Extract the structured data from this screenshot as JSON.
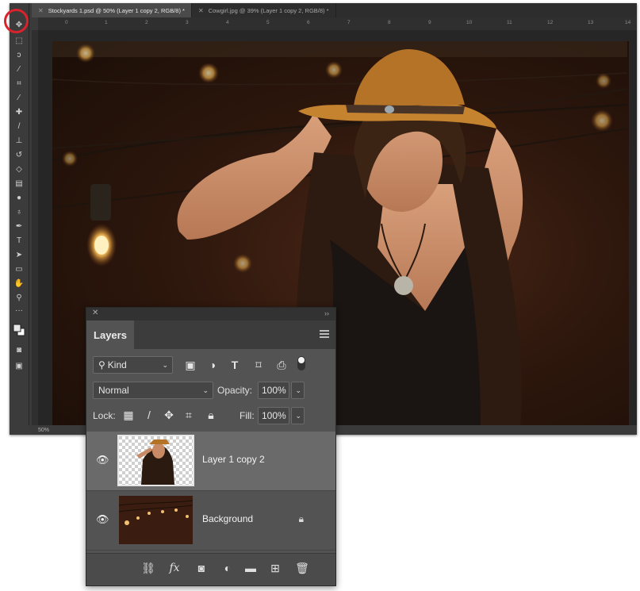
{
  "tabs": [
    {
      "label": "Stockyards 1.psd @ 50% (Layer 1 copy 2, RGB/8) *",
      "active": true
    },
    {
      "label": "Cowgirl.jpg @ 39% (Layer 1 copy 2, RGB/8) *",
      "active": false
    }
  ],
  "ruler_ticks": [
    "0",
    "1",
    "2",
    "3",
    "4",
    "5",
    "6",
    "7",
    "8",
    "9",
    "10",
    "11",
    "12",
    "13",
    "14"
  ],
  "status": {
    "zoom": "50%"
  },
  "toolbar_tools": [
    "move-tool",
    "marquee-tool",
    "lasso-tool",
    "quick-select-tool",
    "crop-tool",
    "eyedropper-tool",
    "healing-tool",
    "brush-tool",
    "clone-stamp-tool",
    "history-brush-tool",
    "eraser-tool",
    "gradient-tool",
    "blur-tool",
    "dodge-tool",
    "pen-tool",
    "type-tool",
    "path-select-tool",
    "rectangle-tool",
    "hand-tool",
    "zoom-tool",
    "more-tools",
    "color-swatches",
    "quick-mask",
    "screen-mode"
  ],
  "accent_colors": {
    "highlight_circle": "#d9232c"
  },
  "layers_panel": {
    "title": "Layers",
    "filter_kind": "Kind",
    "filter_icons": [
      "image-filter-icon",
      "adjustment-filter-icon",
      "type-filter-icon",
      "shape-filter-icon",
      "smart-object-filter-icon",
      "filter-toggle-icon"
    ],
    "blend_mode": "Normal",
    "opacity_label": "Opacity:",
    "opacity_value": "100%",
    "lock_label": "Lock:",
    "fill_label": "Fill:",
    "fill_value": "100%",
    "layers": [
      {
        "name": "Layer 1 copy 2",
        "visible": true,
        "selected": true,
        "locked": false
      },
      {
        "name": "Background",
        "visible": true,
        "selected": false,
        "locked": true
      }
    ],
    "bottom_icons": [
      "link-layers-icon",
      "fx-icon",
      "layer-mask-icon",
      "adjustment-layer-icon",
      "group-folder-icon",
      "new-layer-icon",
      "delete-trash-icon"
    ]
  }
}
